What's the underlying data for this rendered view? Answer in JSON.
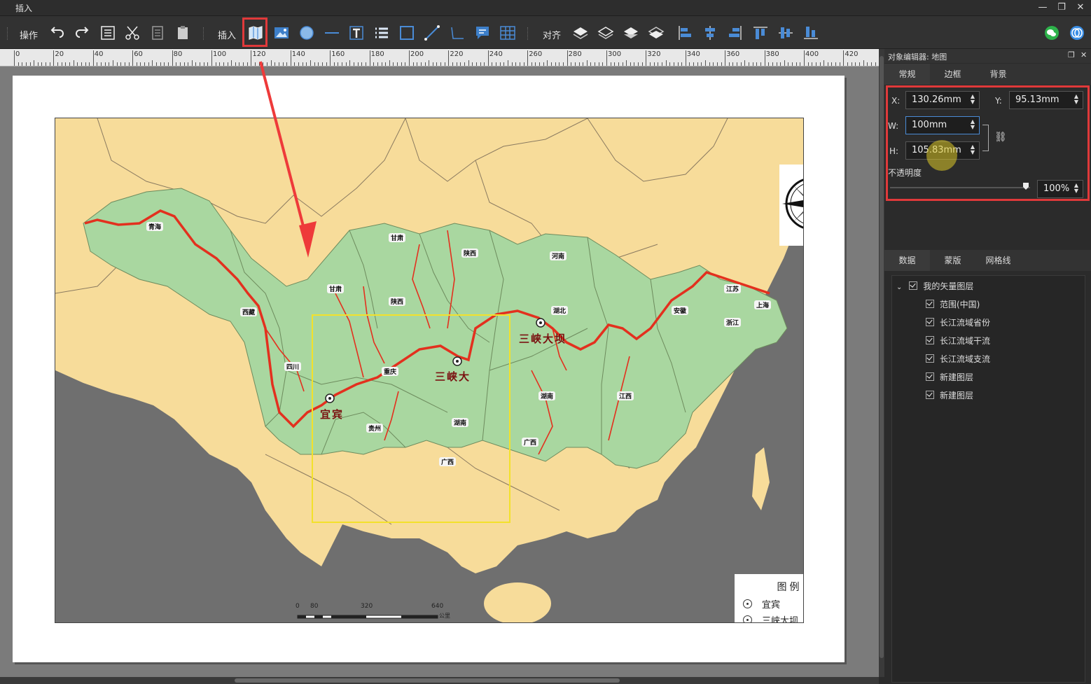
{
  "window": {
    "title": "插入"
  },
  "toolbar": {
    "operate_label": "操作",
    "insert_label": "插入",
    "align_label": "对齐"
  },
  "ruler": {
    "marks": [
      "0",
      "20",
      "40",
      "60",
      "80",
      "100",
      "120",
      "140",
      "160",
      "180",
      "200",
      "220",
      "240",
      "260",
      "280",
      "300",
      "320",
      "340",
      "360",
      "380",
      "400",
      "420"
    ]
  },
  "map": {
    "legend": {
      "title": "图例",
      "items": [
        "宜宾",
        "三峡大坝"
      ]
    },
    "scale": {
      "numbers": [
        "0",
        "80",
        "320",
        "640"
      ],
      "unit": "公里"
    },
    "labels": {
      "qinghai": "青海",
      "xizang": "西藏",
      "sichuan": "四川",
      "gansu_n": "甘肃",
      "shaanxi_n": "陕西",
      "henan": "河南",
      "gansu_s": "甘肃",
      "shaanxi_s": "陕西",
      "chongqing": "重庆",
      "guizhou": "贵州",
      "hunan_l": "湖南",
      "guangxi_l": "广西",
      "hubei": "湖北",
      "hunan": "湖南",
      "jiangxi": "江西",
      "guangxi": "广西",
      "anhui": "安徽",
      "jiangsu": "江苏",
      "shanghai": "上海",
      "zhejiang": "浙江",
      "yibin": "宜宾",
      "sanxia_r": "三峡大坝",
      "sanxia_l": "三峡大"
    }
  },
  "panel": {
    "header": "对象编辑器: 地图",
    "tabs": [
      "常规",
      "边框",
      "背景"
    ],
    "x_label": "X:",
    "x_value": "130.26mm",
    "y_label": "Y:",
    "y_value": "95.13mm",
    "w_label": "W:",
    "w_value": "100mm",
    "h_label": "H:",
    "h_value": "105.83mm",
    "opacity_label": "不透明度",
    "opacity_value": "100%",
    "lower_tabs": [
      "数据",
      "蒙版",
      "网格线"
    ],
    "layers": {
      "root": "我的矢量图层",
      "children": [
        "范围(中国)",
        "长江流域省份",
        "长江流域干流",
        "长江流域支流",
        "新建图层",
        "新建图层"
      ]
    }
  }
}
